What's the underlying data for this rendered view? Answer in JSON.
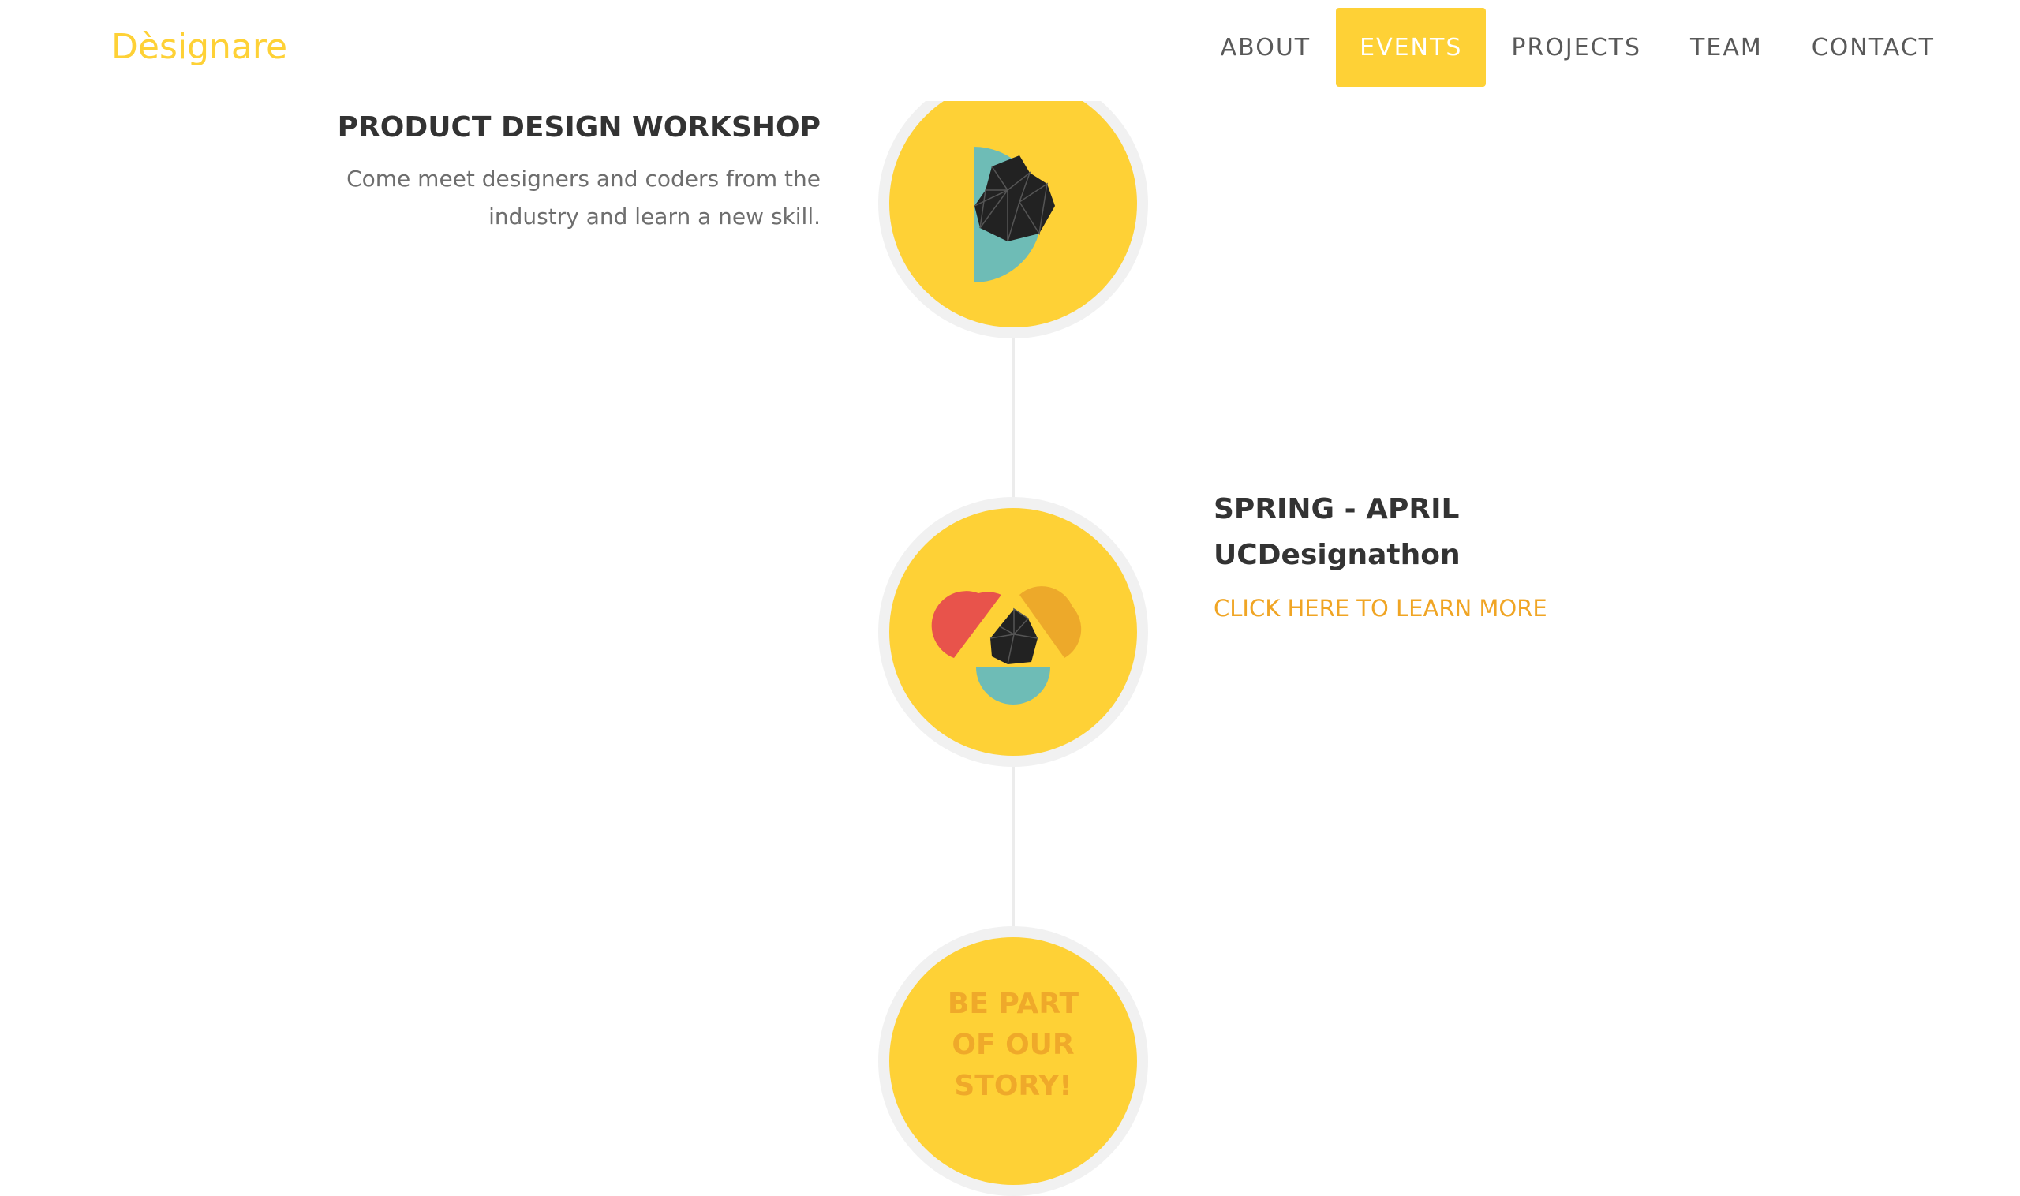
{
  "brand": {
    "name": "Dèsignare",
    "color": "#fed136"
  },
  "nav": {
    "items": [
      {
        "label": "ABOUT",
        "active": false
      },
      {
        "label": "EVENTS",
        "active": true
      },
      {
        "label": "PROJECTS",
        "active": false
      },
      {
        "label": "TEAM",
        "active": false
      },
      {
        "label": "CONTACT",
        "active": false
      }
    ]
  },
  "timeline": {
    "events": [
      {
        "title": "PRODUCT DESIGN WORKSHOP",
        "description_line1": "Come meet designers and coders from the",
        "description_line2": "industry and learn a new skill.",
        "icon": "teal-half-circle-with-black-gem-icon"
      },
      {
        "title_line1": "SPRING - APRIL",
        "title_line2": "UCDesignathon",
        "link": "CLICK HERE TO LEARN MORE",
        "icon": "tricolor-venn-with-black-gem-icon"
      }
    ],
    "final_circle": {
      "line1": "BE PART",
      "line2": "OF OUR",
      "line3": "STORY!"
    }
  },
  "colors": {
    "accent": "#fed136",
    "link": "#f0a524",
    "teal": "#6ebcb6",
    "red": "#e8534b",
    "orange": "#eda92a",
    "ring": "#f1f1f1",
    "line": "#ececec"
  }
}
